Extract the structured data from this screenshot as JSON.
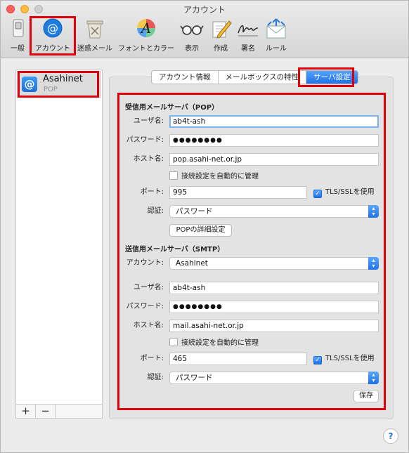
{
  "window": {
    "title": "アカウント"
  },
  "toolbar": {
    "items": [
      {
        "label": "一般",
        "icon": "switch-icon"
      },
      {
        "label": "アカウント",
        "icon": "at-sign-icon"
      },
      {
        "label": "迷惑メール",
        "icon": "junk-trash-icon"
      },
      {
        "label": "フォントとカラー",
        "icon": "font-color-icon"
      },
      {
        "label": "表示",
        "icon": "glasses-icon"
      },
      {
        "label": "作成",
        "icon": "compose-pencil-icon"
      },
      {
        "label": "署名",
        "icon": "signature-icon"
      },
      {
        "label": "ルール",
        "icon": "rules-envelope-icon"
      }
    ]
  },
  "accounts": {
    "items": [
      {
        "name": "Asahinet",
        "type": "POP",
        "icon": "@"
      }
    ],
    "add_label": "+",
    "remove_label": "−"
  },
  "tabs": [
    {
      "label": "アカウント情報",
      "active": false
    },
    {
      "label": "メールボックスの特性",
      "active": false
    },
    {
      "label": "サーバ設定",
      "active": true
    }
  ],
  "incoming": {
    "section_title": "受信用メールサーバ（POP）",
    "username_label": "ユーザ名:",
    "username": "ab4t-ash",
    "password_label": "パスワード:",
    "password": "●●●●●●●●",
    "host_label": "ホスト名:",
    "host": "pop.asahi-net.or.jp",
    "auto_manage_label": "接続設定を自動的に管理",
    "port_label": "ポート:",
    "port": "995",
    "tls_label": "TLS/SSLを使用",
    "auth_label": "認証:",
    "auth_value": "パスワード",
    "advanced_button": "POPの詳細設定"
  },
  "outgoing": {
    "section_title": "送信用メールサーバ（SMTP）",
    "account_label": "アカウント:",
    "account_value": "Asahinet",
    "username_label": "ユーザ名:",
    "username": "ab4t-ash",
    "password_label": "パスワード:",
    "password": "●●●●●●●●",
    "host_label": "ホスト名:",
    "host": "mail.asahi-net.or.jp",
    "auto_manage_label": "接続設定を自動的に管理",
    "port_label": "ポート:",
    "port": "465",
    "tls_label": "TLS/SSLを使用",
    "auth_label": "認証:",
    "auth_value": "パスワード",
    "save_button": "保存"
  },
  "help": {
    "label": "?"
  },
  "colors": {
    "accent": "#1f72e8",
    "highlight_border": "#e0000a"
  }
}
